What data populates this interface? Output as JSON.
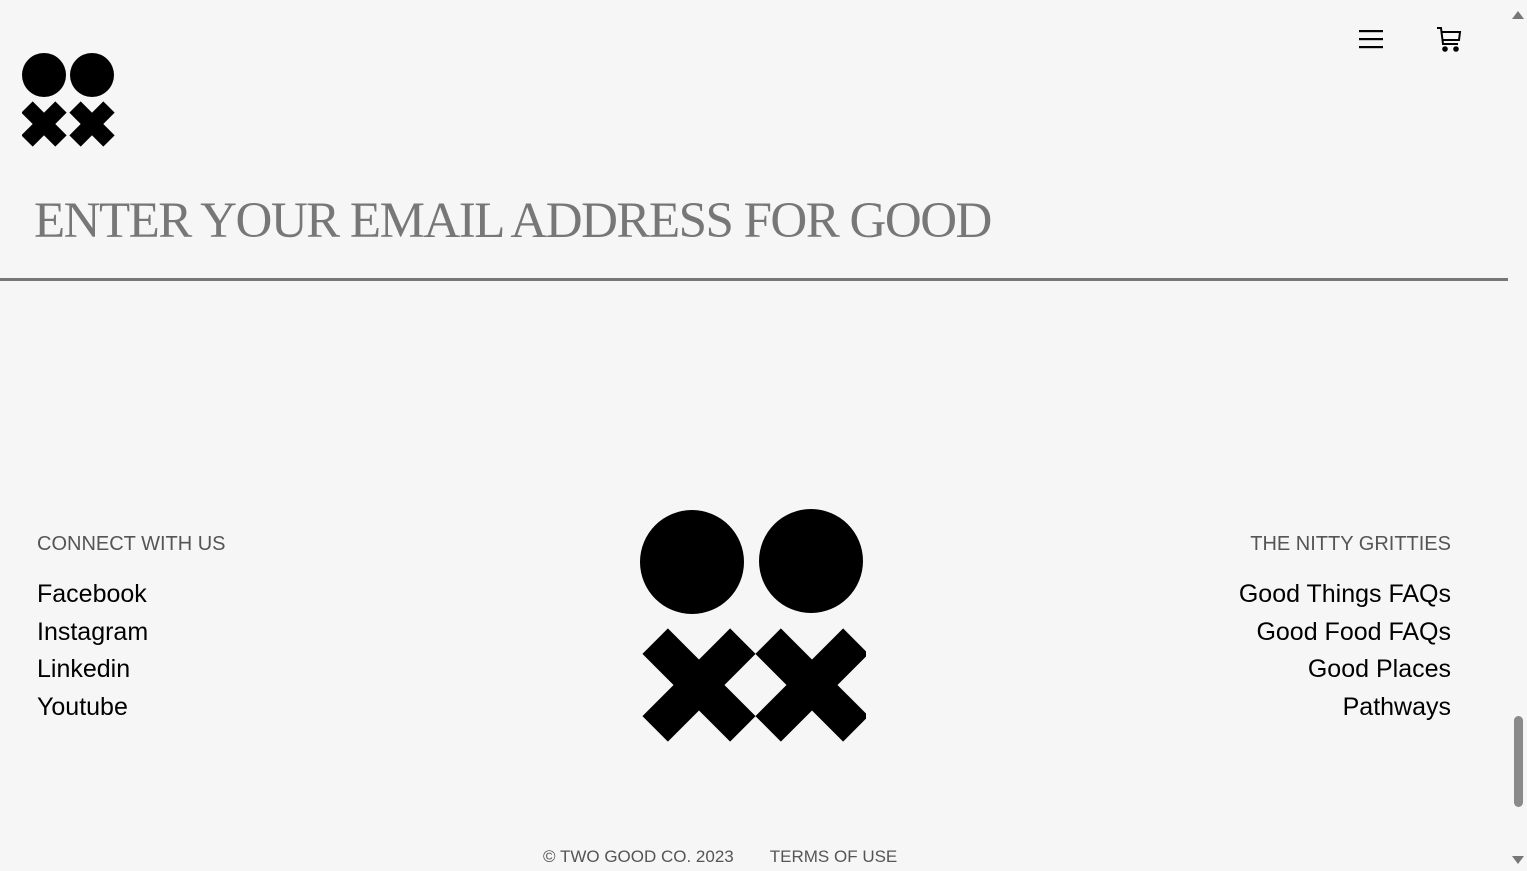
{
  "header": {
    "logo_icon": "two-good-logo-icon",
    "menu_icon": "hamburger-menu-icon",
    "cart_icon": "shopping-cart-icon"
  },
  "newsletter": {
    "placeholder": "ENTER YOUR EMAIL ADDRESS FOR GOOD",
    "value": ""
  },
  "footer": {
    "connect": {
      "heading": "CONNECT WITH US",
      "links": [
        "Facebook",
        "Instagram",
        "Linkedin",
        "Youtube"
      ]
    },
    "nitty": {
      "heading": "THE NITTY GRITTIES",
      "links": [
        "Good Things FAQs",
        "Good Food FAQs",
        "Good Places",
        "Pathways"
      ]
    },
    "copyright": "© TWO GOOD CO. 2023",
    "terms": "TERMS OF USE"
  },
  "colors": {
    "background": "#f6f6f6",
    "text": "#000000",
    "muted": "#777777"
  }
}
